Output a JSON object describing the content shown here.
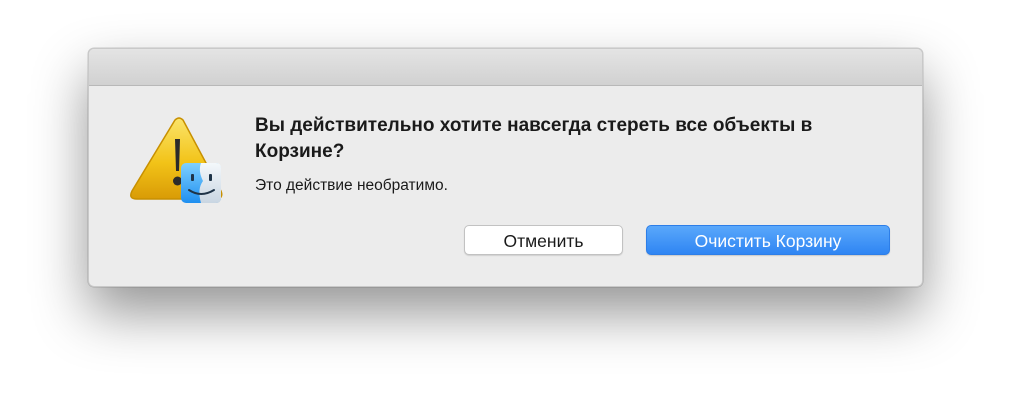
{
  "dialog": {
    "icon": "caution-finder-icon",
    "message": "Вы действительно хотите навсегда стереть все объекты в Корзине?",
    "informative_text": "Это действие необратимо.",
    "buttons": {
      "cancel_label": "Отменить",
      "confirm_label": "Очистить Корзину"
    },
    "colors": {
      "default_button": "#3a8ff7",
      "warning_triangle": "#f2c318",
      "background": "#ececec"
    }
  }
}
